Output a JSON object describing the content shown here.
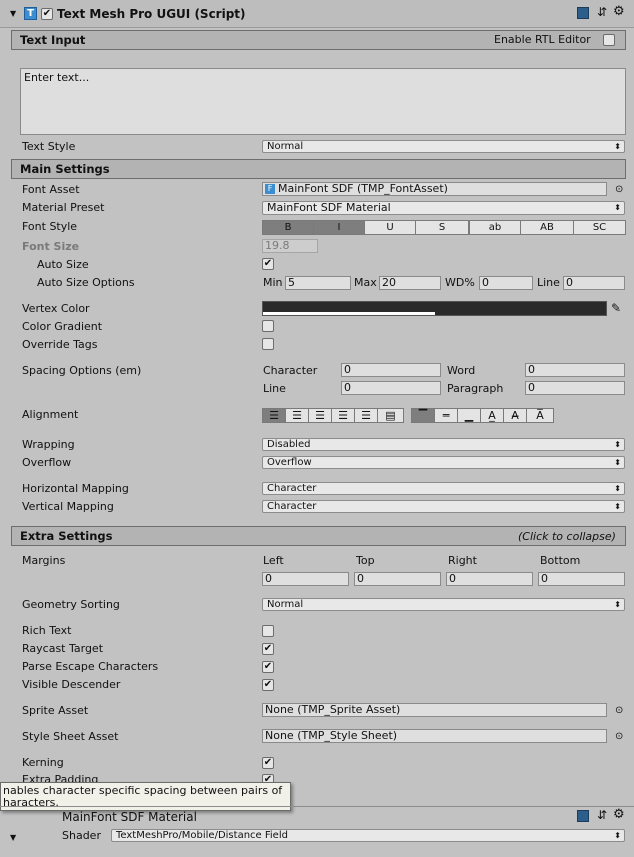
{
  "component": {
    "title": "Text Mesh Pro UGUI (Script)"
  },
  "text_input": {
    "header": "Text Input",
    "rtl_label": "Enable RTL Editor",
    "placeholder": "Enter text...",
    "style_label": "Text Style",
    "style_value": "Normal"
  },
  "main": {
    "header": "Main Settings",
    "font_asset_label": "Font Asset",
    "font_asset_value": "MainFont SDF (TMP_FontAsset)",
    "material_preset_label": "Material Preset",
    "material_preset_value": "MainFont SDF Material",
    "font_style_label": "Font Style",
    "font_style_buttons": [
      "B",
      "I",
      "U",
      "S",
      "ab",
      "AB",
      "SC"
    ],
    "font_size_label": "Font Size",
    "font_size_value": "19.8",
    "auto_size_label": "Auto Size",
    "auto_size_options_label": "Auto Size Options",
    "min_label": "Min",
    "min_value": "5",
    "max_label": "Max",
    "max_value": "20",
    "wd_label": "WD%",
    "wd_value": "0",
    "line_label": "Line",
    "line_value": "0",
    "vertex_color_label": "Vertex Color",
    "color_gradient_label": "Color Gradient",
    "override_tags_label": "Override Tags",
    "spacing_label": "Spacing Options (em)",
    "character_label": "Character",
    "character_value": "0",
    "word_label": "Word",
    "word_value": "0",
    "spacing_line_label": "Line",
    "spacing_line_value": "0",
    "paragraph_label": "Paragraph",
    "paragraph_value": "0",
    "alignment_label": "Alignment",
    "wrapping_label": "Wrapping",
    "wrapping_value": "Disabled",
    "overflow_label": "Overflow",
    "overflow_value": "Overflow",
    "hmap_label": "Horizontal Mapping",
    "hmap_value": "Character",
    "vmap_label": "Vertical Mapping",
    "vmap_value": "Character"
  },
  "extra": {
    "header": "Extra Settings",
    "collapse": "(Click to collapse)",
    "margins_label": "Margins",
    "left_label": "Left",
    "top_label": "Top",
    "right_label": "Right",
    "bottom_label": "Bottom",
    "left": "0",
    "top": "0",
    "right": "0",
    "bottom": "0",
    "geometry_label": "Geometry Sorting",
    "geometry_value": "Normal",
    "rich_text_label": "Rich Text",
    "raycast_label": "Raycast Target",
    "parse_escape_label": "Parse Escape Characters",
    "visible_desc_label": "Visible Descender",
    "sprite_asset_label": "Sprite Asset",
    "sprite_asset_value": "None (TMP_Sprite Asset)",
    "style_sheet_label": "Style Sheet Asset",
    "style_sheet_value": "None (TMP_Style Sheet)",
    "kerning_label": "Kerning",
    "extra_padding_label": "Extra Padding"
  },
  "tooltip": {
    "line1": "nables character specific spacing between pairs of",
    "line2": "haracters."
  },
  "material": {
    "title": "MainFont SDF Material",
    "shader_label": "Shader",
    "shader_value": "TextMeshPro/Mobile/Distance Field"
  },
  "states": {
    "rtl": false,
    "auto_size": true,
    "color_gradient": false,
    "override_tags": false,
    "rich_text": false,
    "raycast": true,
    "parse_escape": true,
    "visible_desc": true,
    "kerning": true,
    "extra_padding": true,
    "font_style_active": [
      "B",
      "I"
    ],
    "alignment_active": [
      0,
      6
    ]
  }
}
